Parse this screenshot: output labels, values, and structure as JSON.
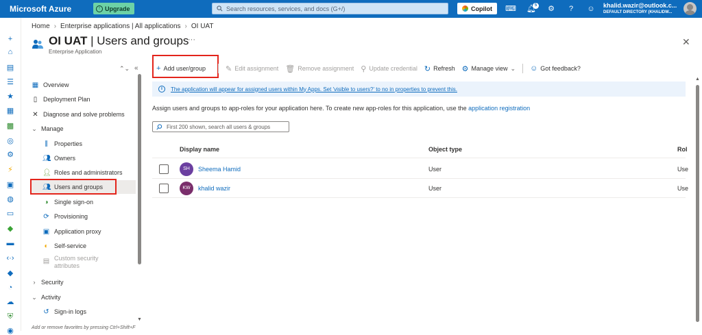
{
  "topbar": {
    "brand": "Microsoft Azure",
    "upgrade": "Upgrade",
    "search_placeholder": "Search resources, services, and docs (G+/)",
    "copilot": "Copilot",
    "notification_count": "5",
    "user_email": "khalid.wazir@outlook.c...",
    "user_directory": "DEFAULT DIRECTORY (KHALIDW...",
    "accent": "#0f6cbd"
  },
  "breadcrumb": [
    "Home",
    "Enterprise applications | All applications",
    "OI UAT"
  ],
  "page": {
    "title_app": "OI UAT",
    "title_section": "Users and groups",
    "subtitle": "Enterprise Application"
  },
  "nav": {
    "overview": "Overview",
    "deployment_plan": "Deployment Plan",
    "diagnose": "Diagnose and solve problems",
    "manage": "Manage",
    "properties": "Properties",
    "owners": "Owners",
    "roles_admins": "Roles and administrators",
    "users_groups": "Users and groups",
    "sso": "Single sign-on",
    "provisioning": "Provisioning",
    "app_proxy": "Application proxy",
    "self_service": "Self-service",
    "custom_sec_1": "Custom security",
    "custom_sec_2": "attributes",
    "security": "Security",
    "activity": "Activity",
    "signin_logs": "Sign-in logs",
    "footer": "Add or remove favorites by pressing Ctrl+Shift+F"
  },
  "toolbar": {
    "add": "Add user/group",
    "edit": "Edit assignment",
    "remove": "Remove assignment",
    "update": "Update credential",
    "refresh": "Refresh",
    "manage_view": "Manage view",
    "feedback": "Got feedback?"
  },
  "info_banner": "The application will appear for assigned users within My Apps. Set 'visible to users?' to no in properties to prevent this.",
  "description": {
    "text": "Assign users and groups to app-roles for your application here. To create new app-roles for this application, use the",
    "link": "application registration"
  },
  "filter_placeholder": "First 200 shown, search all users & groups",
  "table": {
    "headers": [
      "Display name",
      "Object type",
      "Rol"
    ],
    "rows": [
      {
        "initials": "SH",
        "name": "Sheema Hamid",
        "type": "User",
        "role": "Use",
        "color": "#6b3fa0"
      },
      {
        "initials": "KW",
        "name": "khalid wazir",
        "type": "User",
        "role": "Use",
        "color": "#7a2e6b"
      }
    ]
  }
}
